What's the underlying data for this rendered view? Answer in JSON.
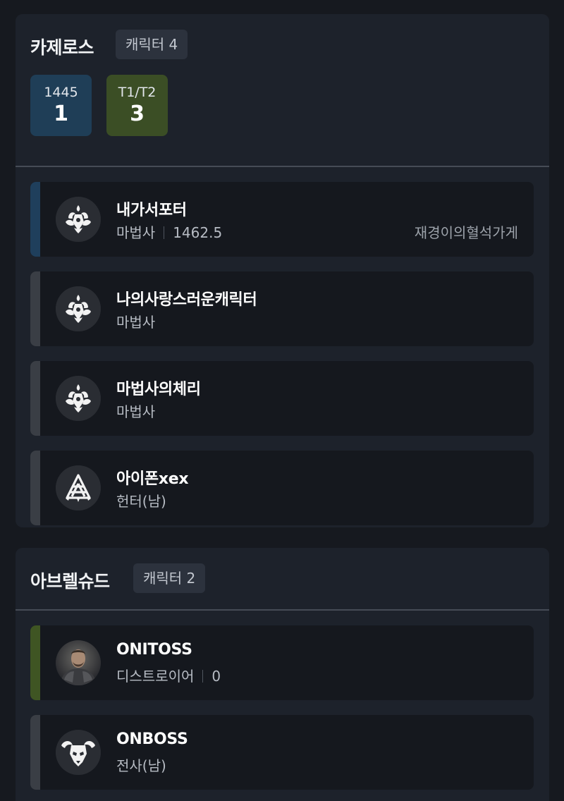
{
  "servers": [
    {
      "name": "카제로스",
      "count_label": "캐릭터 4",
      "stats": [
        {
          "label": "1445",
          "value": "1"
        },
        {
          "label": "T1/T2",
          "value": "3"
        }
      ],
      "characters": [
        {
          "name": "내가서포터",
          "class": "마법사",
          "item_level": "1462.5",
          "guild": "재경이의혈석가게",
          "avatar_icon": "sorceress-emblem-icon",
          "accent": "#1f3f5c"
        },
        {
          "name": "나의사랑스러운캐릭터",
          "class": "마법사",
          "avatar_icon": "sorceress-emblem-icon",
          "accent": "#3a3e45"
        },
        {
          "name": "마법사의체리",
          "class": "마법사",
          "avatar_icon": "sorceress-emblem-icon",
          "accent": "#3a3e45"
        },
        {
          "name": "아이폰xex",
          "class": "헌터(남)",
          "avatar_icon": "hunter-emblem-icon",
          "accent": "#3a3e45"
        }
      ]
    },
    {
      "name": "아브렐슈드",
      "count_label": "캐릭터 2",
      "characters": [
        {
          "name": "ONITOSS",
          "class": "디스트로이어",
          "item_level": "0",
          "avatar_icon": "character-portrait",
          "accent": "#3f5523"
        },
        {
          "name": "ONBOSS",
          "class": "전사(남)",
          "avatar_icon": "warrior-emblem-icon",
          "accent": "#3a3e45"
        }
      ]
    }
  ]
}
